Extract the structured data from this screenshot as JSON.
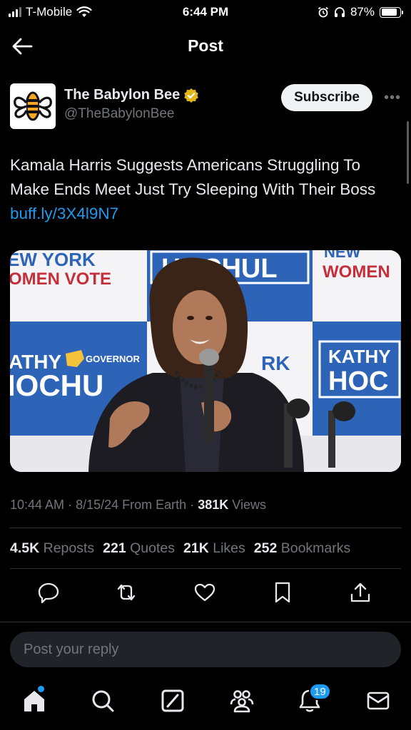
{
  "status_bar": {
    "carrier": "T-Mobile",
    "time": "6:44 PM",
    "battery": "87%",
    "battery_level": 0.87,
    "icons": [
      "signal-icon",
      "wifi-icon",
      "alarm-icon",
      "headphones-icon",
      "battery-icon"
    ]
  },
  "header": {
    "title": "Post",
    "back_icon": "arrow-left-icon"
  },
  "author": {
    "name": "The Babylon Bee",
    "handle": "@TheBabylonBee",
    "verified": true,
    "subscribe_label": "Subscribe",
    "more_label": "•••"
  },
  "post": {
    "text": "Kamala Harris Suggests Americans Struggling To Make Ends Meet Just Try Sleeping With Their Boss ",
    "link": "buff.ly/3X4l9N7",
    "image_signs": {
      "left_top": "EW YORK",
      "left_mid": "OMEN VOTE",
      "center_top": "HOCHUL",
      "right_top": "NEW",
      "right_mid": "WOMEN",
      "left_kathy": "ATHY",
      "left_governor": "GOVERNOR",
      "left_hochul": "IOCHU",
      "center_rk": "RK",
      "right_kathy": "KATHY",
      "right_hochul": "HOC"
    }
  },
  "meta": {
    "time": "10:44 AM",
    "date": "8/15/24",
    "source": "From Earth",
    "views_count": "381K",
    "views_label": "Views",
    "sep": "·"
  },
  "stats": [
    {
      "count": "4.5K",
      "label": "Reposts"
    },
    {
      "count": "221",
      "label": "Quotes"
    },
    {
      "count": "21K",
      "label": "Likes"
    },
    {
      "count": "252",
      "label": "Bookmarks"
    }
  ],
  "actions": [
    "reply-icon",
    "repost-icon",
    "like-icon",
    "bookmark-icon",
    "share-icon"
  ],
  "reply": {
    "placeholder": "Post your reply"
  },
  "tabbar": {
    "items": [
      "home-icon",
      "search-icon",
      "grok-icon",
      "communities-icon",
      "notifications-icon",
      "messages-icon"
    ],
    "notifications_badge": "19"
  },
  "colors": {
    "background": "#000000",
    "text": "#e7e9ea",
    "muted": "#71767b",
    "accent": "#1d9bf0",
    "divider": "#2f3336",
    "verified_gold": "#e2b719"
  }
}
